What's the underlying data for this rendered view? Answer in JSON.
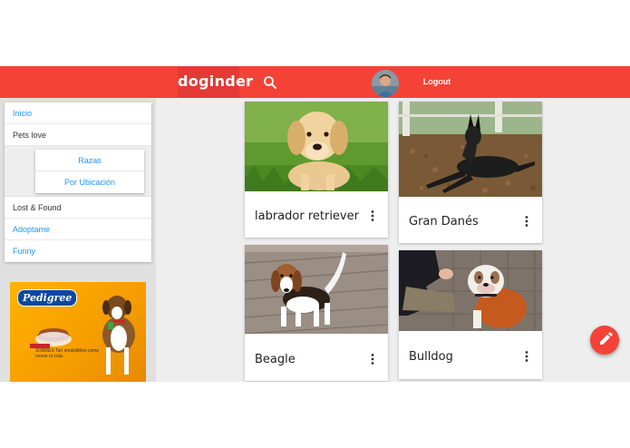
{
  "header": {
    "brand": "doginder",
    "logout_label": "Logout"
  },
  "sidebar": {
    "menu": [
      {
        "label": "Inicio"
      },
      {
        "label": "Pets love"
      },
      {
        "label": "Lost & Found"
      },
      {
        "label": "Adoptame"
      },
      {
        "label": "Funny"
      }
    ],
    "submenu": [
      {
        "label": "Razas"
      },
      {
        "label": "Por Ubicación"
      }
    ],
    "ad": {
      "brand": "Pedigree",
      "text": "SOBRES Tan irresistibles como mover la cola."
    }
  },
  "cards": [
    {
      "title": "labrador retriever"
    },
    {
      "title": "Gran Danés"
    },
    {
      "title": "Beagle"
    },
    {
      "title": "Bulldog"
    }
  ],
  "colors": {
    "primary": "#f44336",
    "primary_dark": "#e53935",
    "link": "#2196f3",
    "background": "#eeeeee"
  },
  "icons": {
    "search": "search-icon",
    "more": "more-vert-icon",
    "fab": "pencil-icon"
  }
}
